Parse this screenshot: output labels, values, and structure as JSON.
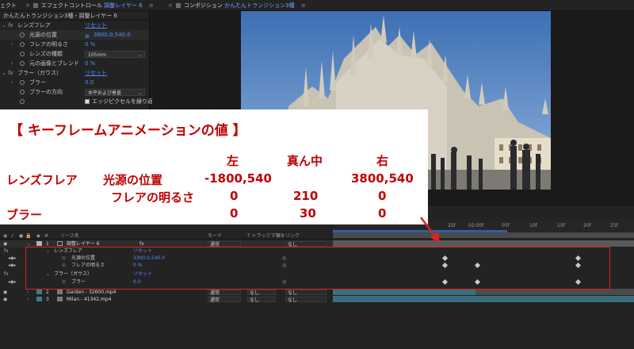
{
  "tabs": {
    "project_partial": "ェクト",
    "effect_controls_label": "エフェクトコントロール",
    "effect_controls_layer": "調整レイヤー 6",
    "composition_label": "コンポジション",
    "composition_name": "かんたんトランジション3種"
  },
  "effect_controls": {
    "header": "かんたんトランジション3種・調整レイヤー 6",
    "lens_flare": {
      "name": "レンズフレア",
      "reset": "リセット",
      "flare_center_label": "光源の位置",
      "flare_center_value": "3800.0,540.0",
      "brightness_label": "フレアの明るさ",
      "brightness_value": "0 %",
      "lens_type_label": "レンズの種類",
      "lens_type_value": "105mm",
      "blend_label": "元の画像とブレンド",
      "blend_value": "0 %"
    },
    "blur": {
      "name": "ブラー（ガウス）",
      "reset": "リセット",
      "blurriness_label": "ブラー",
      "blurriness_value": "0.0",
      "direction_label": "ブラーの方向",
      "direction_value": "水平および垂直",
      "repeat_edge_label": "エッジピクセルを繰り返"
    }
  },
  "annotation": {
    "title": "【 キーフレームアニメーションの値 】",
    "col_left": "左",
    "col_middle": "真ん中",
    "col_right": "右",
    "row1_effect": "レンズフレア",
    "row1_prop": "光源の位置",
    "row1_left": "-1800,540",
    "row1_right": "3800,540",
    "row2_prop": "フレアの明るさ",
    "row2_left": "0",
    "row2_middle": "210",
    "row2_right": "0",
    "row3_effect": "ブラー",
    "row3_left": "0",
    "row3_middle": "30",
    "row3_right": "0"
  },
  "timeline": {
    "ruler_labels": [
      "25f",
      "02:00f",
      "05f",
      "10f",
      "15f",
      "20f",
      "25f"
    ],
    "col_source_name": "ソース名",
    "col_mode": "モード",
    "col_trkmat": "T トラックマット",
    "col_parent": "親とリンク",
    "layers": [
      {
        "num": "1",
        "name": "調整レイヤー 6",
        "mode": "通常",
        "parent": "なし"
      },
      {
        "num": "2",
        "name": "Garden - 32600.mp4",
        "mode": "通常",
        "trkmat": "なし",
        "parent": "なし"
      },
      {
        "num": "3",
        "name": "Milan - 41342.mp4",
        "mode": "通常",
        "trkmat": "なし",
        "parent": "なし"
      }
    ],
    "props": {
      "lens_flare": "レンズフレア",
      "lens_flare_reset": "リセット",
      "flare_center": "光源の位置",
      "flare_center_value": "3300.0,540.0",
      "brightness": "フレアの明るさ",
      "brightness_value": "0 %",
      "blur": "ブラー（ガウス）",
      "blur_reset": "リセット",
      "blurriness": "ブラー",
      "blurriness_value": "0.0"
    }
  }
}
